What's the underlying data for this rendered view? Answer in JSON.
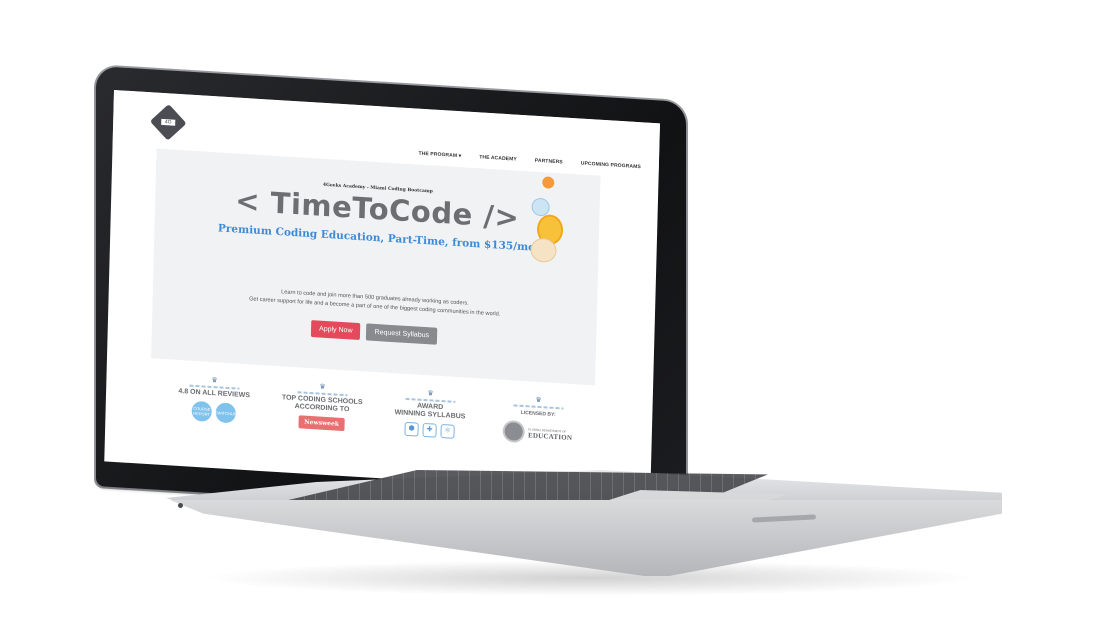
{
  "site": {
    "logo_text": "4G",
    "nav": [
      {
        "label": "THE PROGRAM ▾"
      },
      {
        "label": "THE ACADEMY"
      },
      {
        "label": "PARTNERS"
      },
      {
        "label": "UPCOMING PROGRAMS"
      }
    ],
    "hero": {
      "eyebrow": "4Geeks Academy - Miami Coding Bootcamp",
      "headline": "< TimeToCode />",
      "tagline": "Premium Coding Education, Part-Time, from $135/mo",
      "intro_line1": "Learn to code and join more than 500 graduates already working as coders.",
      "intro_line2": "Get career support for life and a become a part of one of the biggest coding communities in the world.",
      "apply_label": "Apply Now",
      "syllabus_label": "Request Syllabus"
    },
    "badges": [
      {
        "title_line1": "4.8 ON ALL REVIEWS",
        "title_line2": "",
        "logos": [
          "COURSE REPORT",
          "SWITCHUP"
        ]
      },
      {
        "title_line1": "TOP CODING SCHOOLS",
        "title_line2": "ACCORDING TO",
        "logos": [
          "Newsweek"
        ]
      },
      {
        "title_line1": "AWARD",
        "title_line2": "WINNING SYLLABUS",
        "logos": [
          "JS",
          "PY",
          "REACT"
        ]
      },
      {
        "title_line1": "LICENSED BY:",
        "title_line2": "",
        "logos": [
          "FLORIDA DEPARTMENT OF",
          "EDUCATION"
        ]
      }
    ],
    "colors": {
      "accent_blue": "#3c8ad8",
      "apply_red": "#e44a5b",
      "syllabus_gray": "#888a8e"
    }
  }
}
